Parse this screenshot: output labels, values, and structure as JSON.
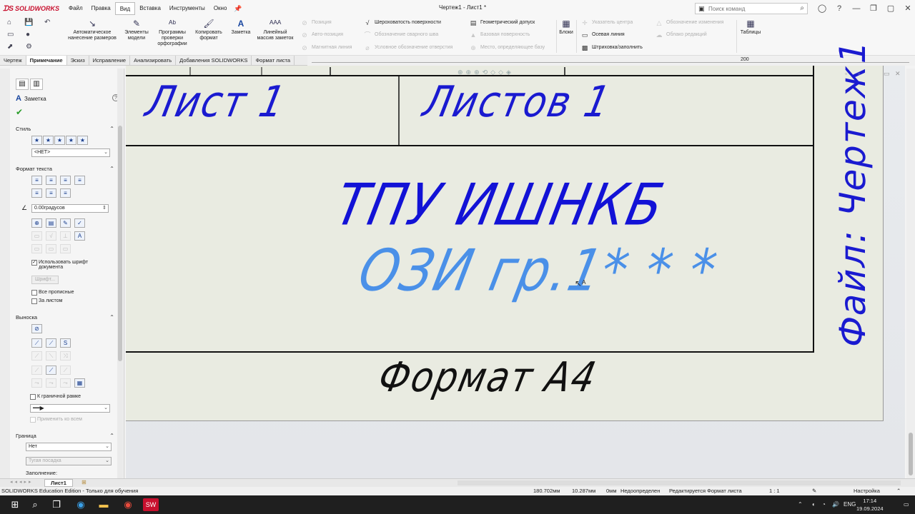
{
  "app": {
    "logo": "SOLIDWORKS",
    "doc_title": "Чертеж1 - Лист1 *",
    "search_placeholder": "Поиск команд"
  },
  "menu": [
    "Файл",
    "Правка",
    "Вид",
    "Вставка",
    "Инструменты",
    "Окно"
  ],
  "menu_active": "Вид",
  "ribbon": {
    "auto_dims": "Автоматическое нанесение размеров",
    "model_items": "Элементы модели",
    "spell_check": "Программы проверки орфографии",
    "copy_format": "Копировать формат",
    "note": "Заметка",
    "linear_notes": "Линейный массив заметок",
    "balloon": "Позиция",
    "auto_balloon": "Авто-позиция",
    "magnet_line": "Магнитная линия",
    "surface_finish": "Шероховатость поверхности",
    "weld_symbol": "Обозначение сварного шва",
    "hole_callout": "Условное обозначение отверстия",
    "geom_tol": "Геометрический допуск",
    "datum_feature": "Базовая поверхность",
    "datum_target": "Место, определяющее базу",
    "blocks": "Блоки",
    "center_mark": "Указатель центра",
    "centerline": "Осевая линия",
    "hatch": "Штриховка/заполнить",
    "revision_symbol": "Обозначение изменения",
    "revision_cloud": "Облако редакций",
    "tables": "Таблицы"
  },
  "tabs": [
    "Чертеж",
    "Примечание",
    "Эскиз",
    "Исправление",
    "Анализировать",
    "Добавления SOLIDWORKS",
    "Формат листа"
  ],
  "tab_active": "Примечание",
  "ruler_value": "200",
  "panel": {
    "title": "Заметка",
    "style_header": "Стиль",
    "style_value": "<НЕТ>",
    "text_format_header": "Формат текста",
    "angle_value": "0.00градусов",
    "use_doc_font": "Использовать шрифт документа",
    "font_button": "Шрифт...",
    "all_caps": "Все прописные",
    "behind_sheet": "За листом",
    "leader_header": "Выноска",
    "to_border": "К граничной рамке",
    "apply_all": "Применить ко всем",
    "border_header": "Граница",
    "border_value": "Нет",
    "fit_value": "Тугая посадка",
    "fill_label": "Заполнение:"
  },
  "drawing": {
    "sheet_label": "Лист 1",
    "sheets_label": "Листов 1",
    "org": "ТПУ ИШНКБ",
    "group": "ОЗИ гр.1* * *",
    "format": "Формат А4",
    "file": "Файл: Чертеж1"
  },
  "sheet_tab": "Лист1",
  "status": {
    "edition": "SOLIDWORKS Education Edition - Только для обучения",
    "x": "180.702мм",
    "y": "10.287мм",
    "z": "0мм",
    "defined": "Недоопределен",
    "editing": "Редактируется Формат листа",
    "scale": "1 : 1",
    "settings": "Настройка"
  },
  "taskbar": {
    "lang": "ENG",
    "time": "17:14",
    "date": "19.09.2024"
  },
  "colors": {
    "note_blue": "#1a1ad0",
    "selected_note": "#4a90e8",
    "sheet_bg": "#e9ebe1"
  }
}
